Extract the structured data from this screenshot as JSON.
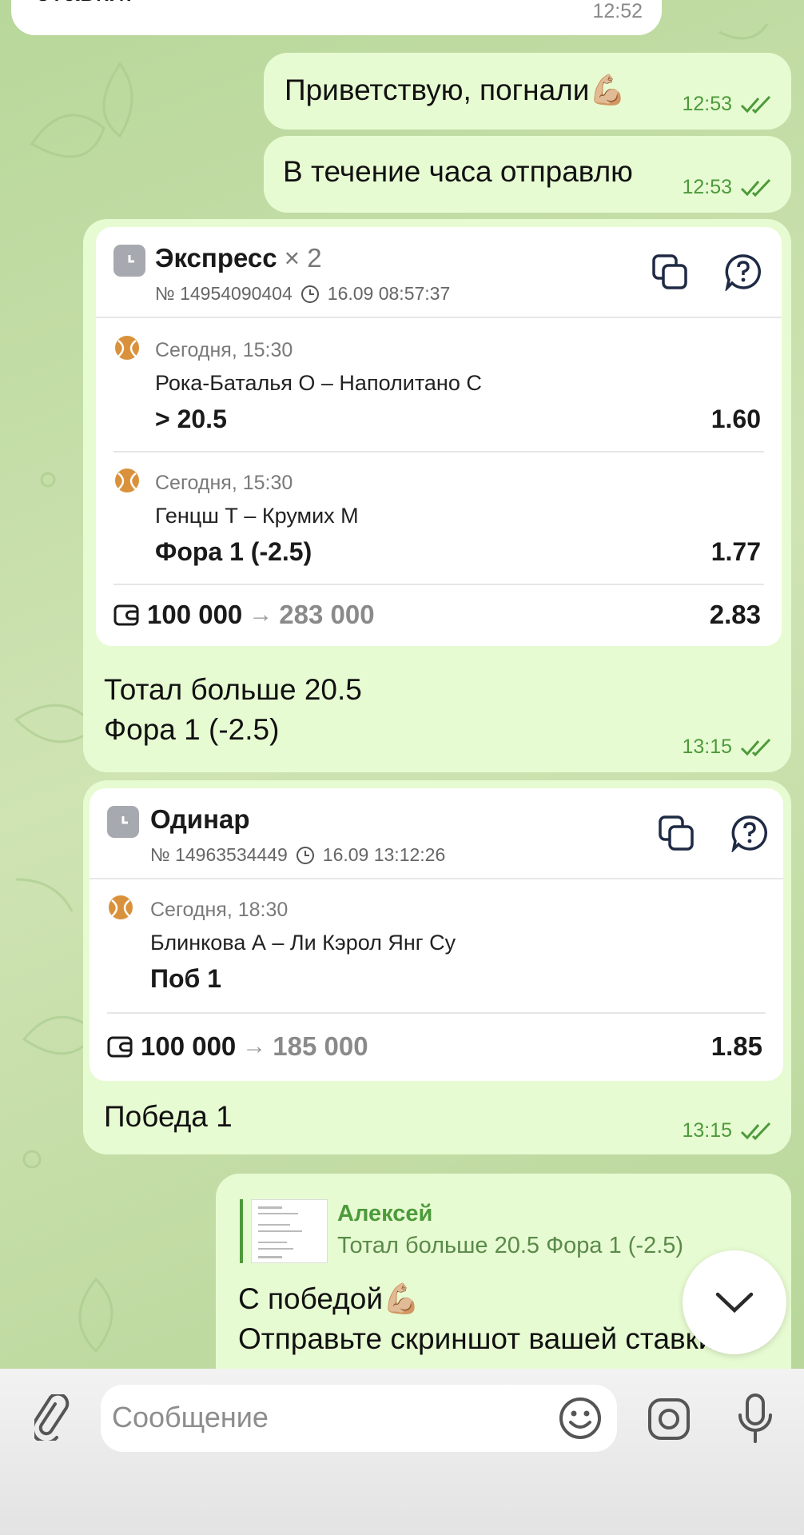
{
  "messages": {
    "prev_incoming": {
      "text": "ставки.",
      "time": "12:52"
    },
    "msg1": {
      "text": "Приветствую, погнали💪🏼",
      "time": "12:53"
    },
    "msg2": {
      "text": "В течение часа отправлю",
      "time": "12:53"
    },
    "bet1": {
      "type": "Экспресс",
      "multiplier": "× 2",
      "number": "№ 14954090404",
      "datetime": "16.09 08:57:37",
      "events": [
        {
          "date": "Сегодня, 15:30",
          "match": "Рока-Баталья О – Наполитано С",
          "pick": "> 20.5",
          "odds": "1.60"
        },
        {
          "date": "Сегодня, 15:30",
          "match": "Генцш Т – Крумих М",
          "pick": "Фора 1 (-2.5)",
          "odds": "1.77"
        }
      ],
      "stake": "100 000",
      "arrow": "→",
      "payout": "283 000",
      "total_odds": "2.83",
      "caption_line1": "Тотал больше 20.5",
      "caption_line2": "Фора 1 (-2.5)",
      "time": "13:15"
    },
    "bet2": {
      "type": "Одинар",
      "number": "№ 14963534449",
      "datetime": "16.09 13:12:26",
      "events": [
        {
          "date": "Сегодня, 18:30",
          "match": "Блинкова А – Ли Кэрол Янг Су",
          "pick": "Поб 1"
        }
      ],
      "stake": "100 000",
      "arrow": "→",
      "payout": "185 000",
      "total_odds": "1.85",
      "caption": "Победа 1",
      "time": "13:15"
    },
    "reply_msg": {
      "reply_name": "Алексей",
      "reply_text": "Тотал больше 20.5 Фора 1 (-2.5)",
      "line1": "С победой💪🏼",
      "line2": "Отправьте  скриншот вашей ставки"
    }
  },
  "composer": {
    "placeholder": "Сообщение"
  },
  "icons": {
    "attach": "paperclip-icon",
    "emoji": "emoji-icon",
    "camera": "camera-icon",
    "mic": "microphone-icon",
    "scroll": "chevron-down-icon",
    "copy": "copy-icon",
    "help": "help-icon"
  },
  "colors": {
    "outgoing_bubble": "#e7fbd2",
    "accent_green": "#4d9a3b",
    "background": "#c3dca6"
  }
}
